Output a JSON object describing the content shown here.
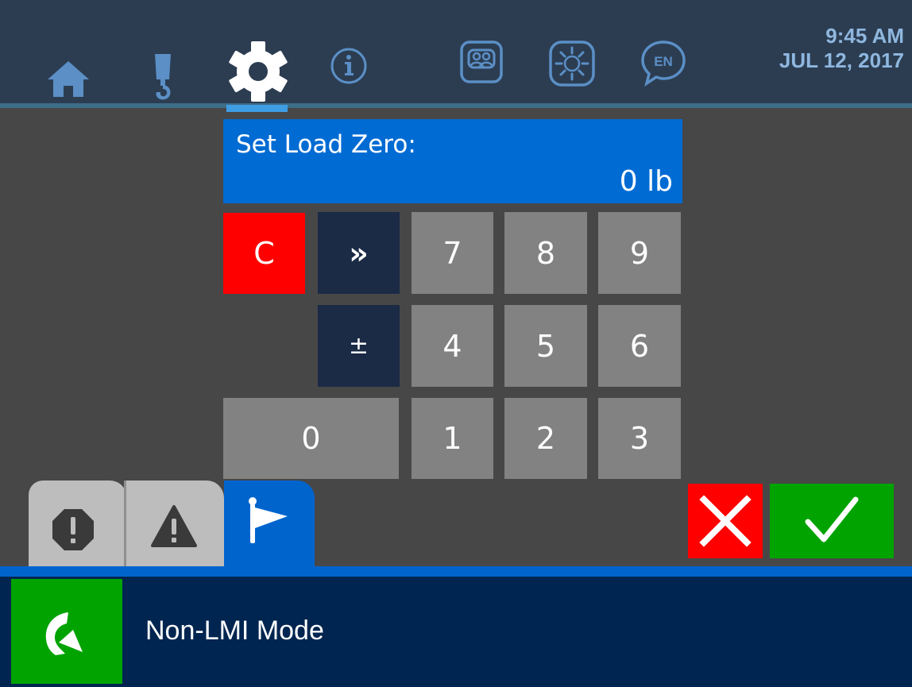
{
  "header": {
    "time": "9:45 AM",
    "date": "JUL 12, 2017",
    "nav_icons": [
      "home-icon",
      "crane-hook-icon",
      "settings-gear-icon",
      "info-icon",
      "operators-icon",
      "brightness-icon",
      "language-icon"
    ],
    "language_code": "EN",
    "active_tab": "settings"
  },
  "display": {
    "label": "Set Load Zero:",
    "value": "0 lb"
  },
  "keypad": {
    "clear": "C",
    "next": "»",
    "sign": "±",
    "digits": {
      "k7": "7",
      "k8": "8",
      "k9": "9",
      "k4": "4",
      "k5": "5",
      "k6": "6",
      "k0": "0",
      "k1": "1",
      "k2": "2",
      "k3": "3"
    }
  },
  "tabs": {
    "items": [
      "stop-alarm-icon",
      "warning-icon",
      "flag-icon"
    ],
    "active": "flag"
  },
  "actions": {
    "cancel_icon": "close-x-icon",
    "confirm_icon": "checkmark-icon"
  },
  "footer": {
    "mode_label": "Non-LMI Mode",
    "mode_icon": "mode-arrow-icon"
  },
  "colors": {
    "display_blue": "#006bd3",
    "clear_red": "#ff0000",
    "confirm_green": "#00a300",
    "footer_navy": "#002550",
    "topbar": "#2c3d52"
  }
}
